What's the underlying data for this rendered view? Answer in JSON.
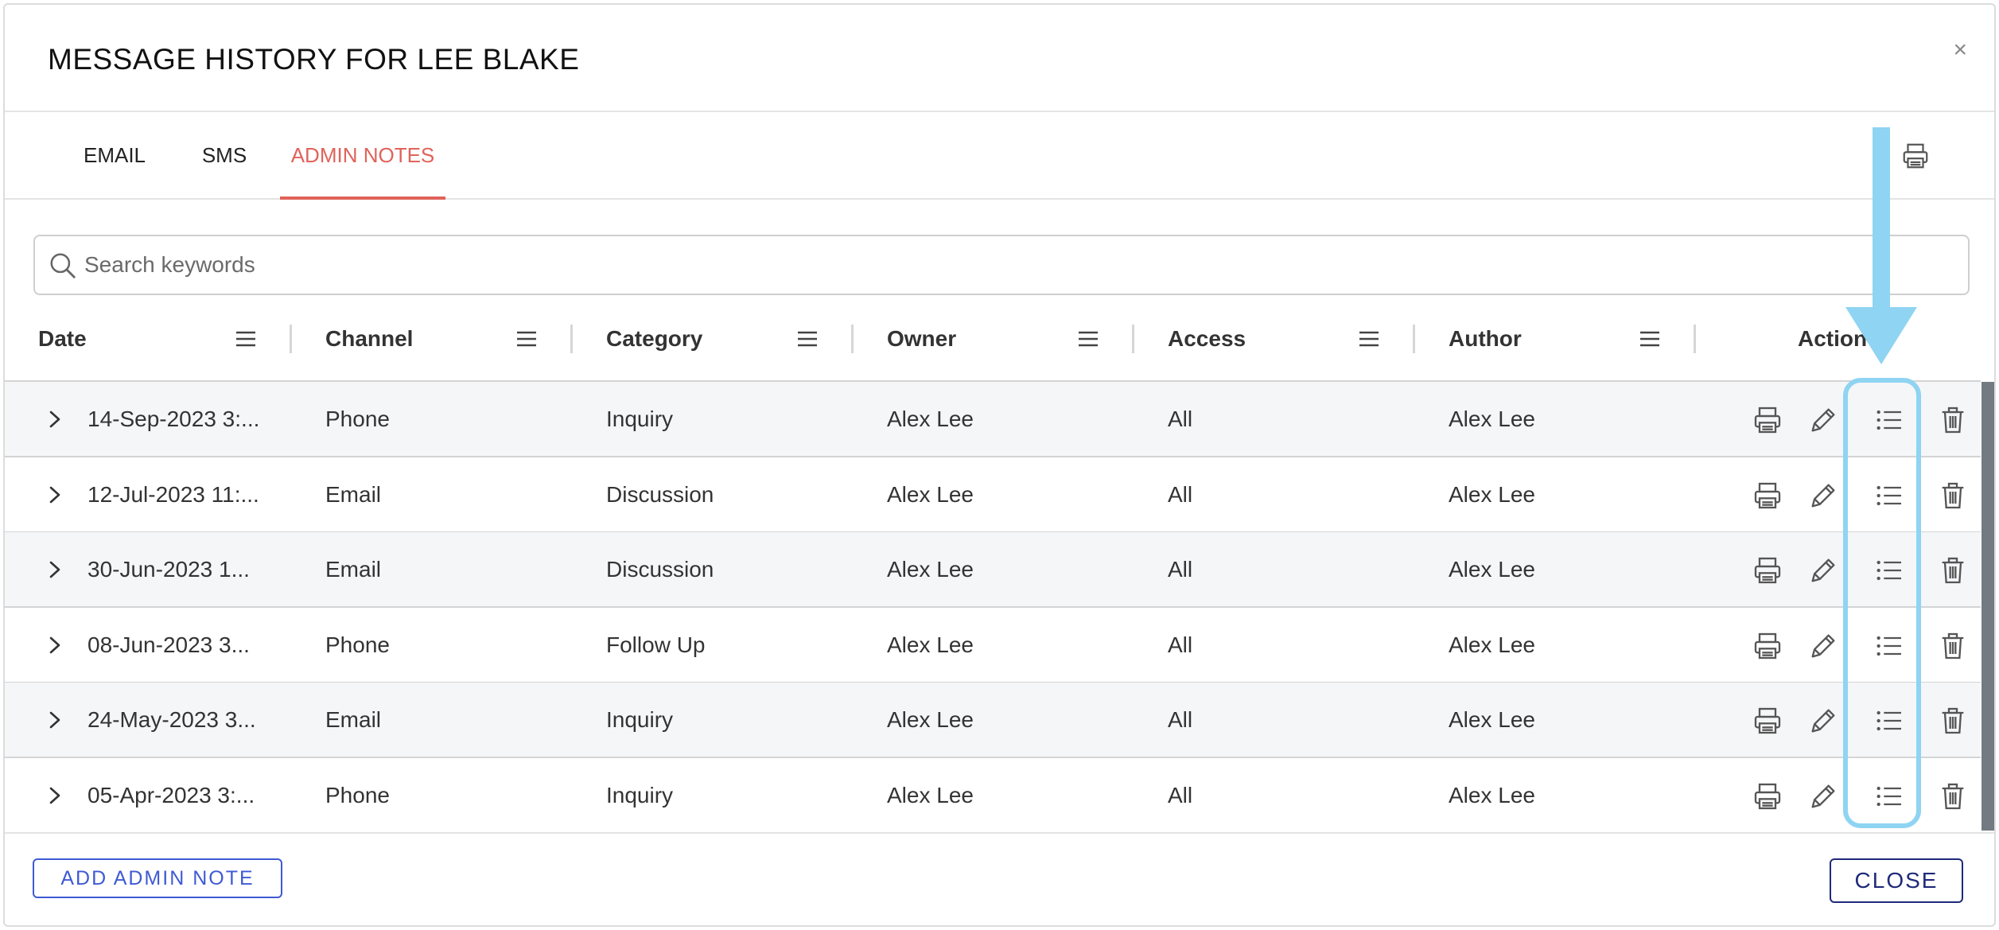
{
  "modal": {
    "title": "MESSAGE HISTORY FOR LEE BLAKE",
    "close_symbol": "×"
  },
  "tabs": [
    {
      "label": "EMAIL",
      "active": false
    },
    {
      "label": "SMS",
      "active": false
    },
    {
      "label": "ADMIN NOTES",
      "active": true
    }
  ],
  "search": {
    "placeholder": "Search keywords",
    "value": ""
  },
  "table": {
    "columns": [
      "Date",
      "Channel",
      "Category",
      "Owner",
      "Access",
      "Author",
      "Action"
    ],
    "rows": [
      {
        "date": "14-Sep-2023 3:...",
        "channel": "Phone",
        "category": "Inquiry",
        "owner": "Alex Lee",
        "access": "All",
        "author": "Alex Lee"
      },
      {
        "date": "12-Jul-2023 11:...",
        "channel": "Email",
        "category": "Discussion",
        "owner": "Alex Lee",
        "access": "All",
        "author": "Alex Lee"
      },
      {
        "date": "30-Jun-2023 1...",
        "channel": "Email",
        "category": "Discussion",
        "owner": "Alex Lee",
        "access": "All",
        "author": "Alex Lee"
      },
      {
        "date": "08-Jun-2023 3...",
        "channel": "Phone",
        "category": "Follow Up",
        "owner": "Alex Lee",
        "access": "All",
        "author": "Alex Lee"
      },
      {
        "date": "24-May-2023 3...",
        "channel": "Email",
        "category": "Inquiry",
        "owner": "Alex Lee",
        "access": "All",
        "author": "Alex Lee"
      },
      {
        "date": "05-Apr-2023 3:...",
        "channel": "Phone",
        "category": "Inquiry",
        "owner": "Alex Lee",
        "access": "All",
        "author": "Alex Lee"
      }
    ],
    "row_actions": [
      "print-icon",
      "edit-pencil-icon",
      "list-icon",
      "trash-icon"
    ]
  },
  "footer": {
    "add_label": "ADD ADMIN NOTE",
    "close_label": "CLOSE"
  },
  "colors": {
    "active_tab": "#e0635a",
    "primary_button": "#3f5ad4",
    "close_button": "#1f2a7a",
    "annotation": "#8fd4f2"
  }
}
